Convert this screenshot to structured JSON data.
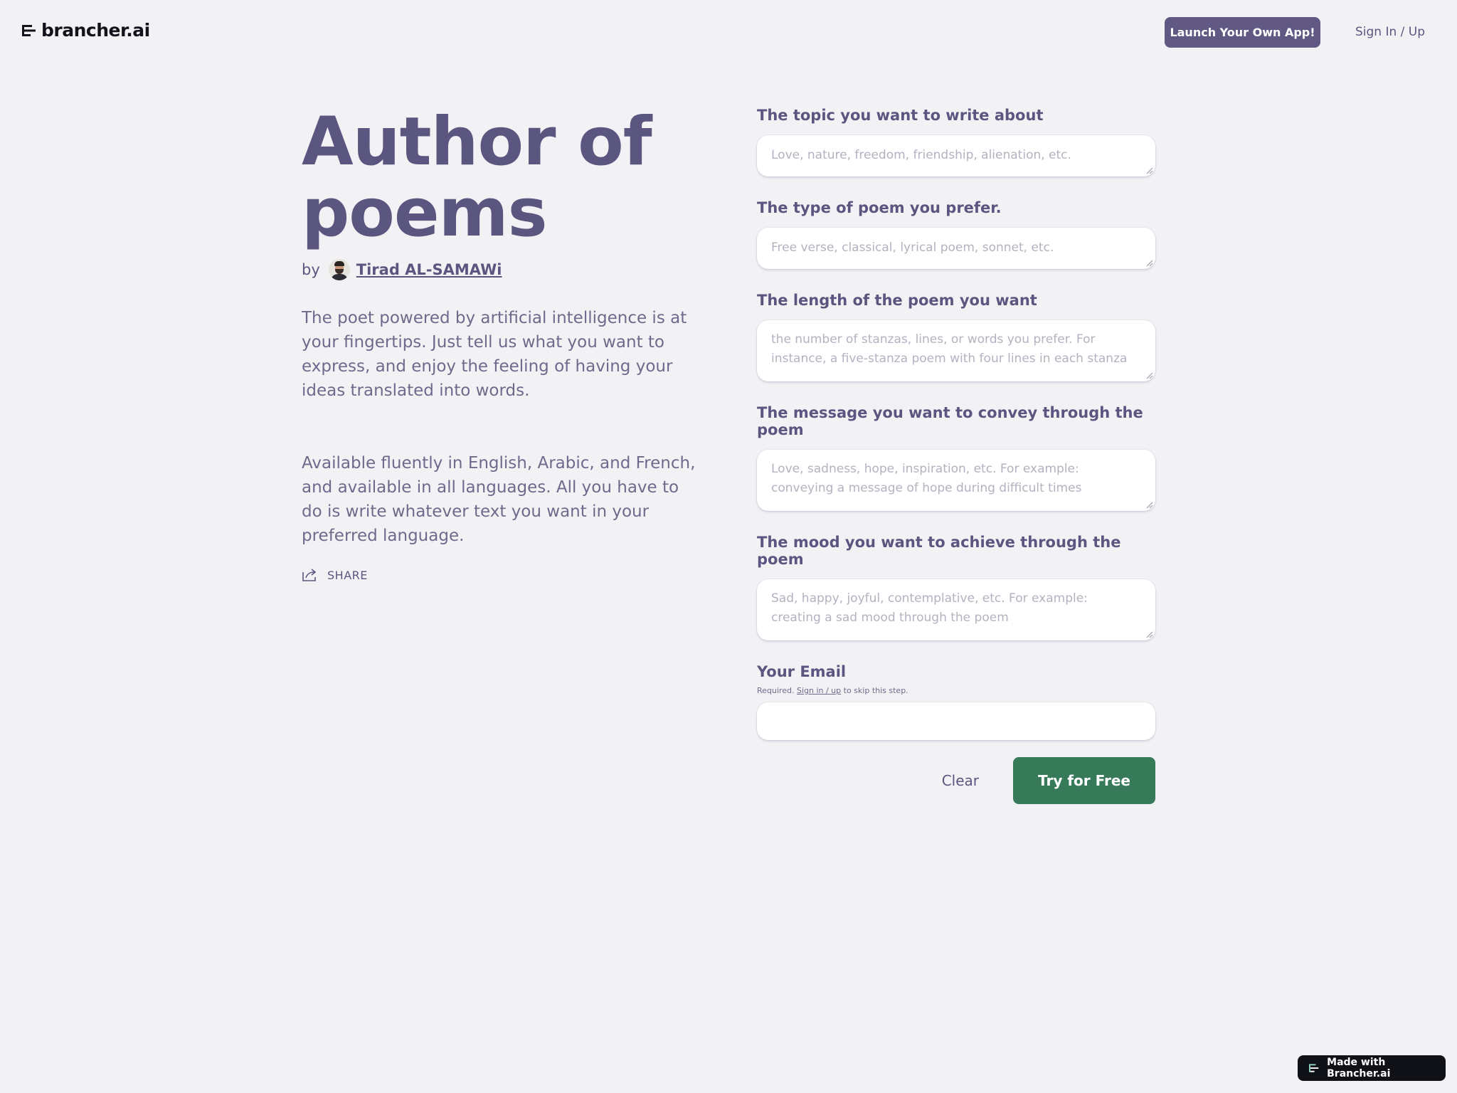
{
  "header": {
    "logo_text": "brancher.ai",
    "launch_label": "Launch Your Own App!",
    "signin_label": "Sign In / Up"
  },
  "intro": {
    "title": "Author of poems",
    "by": "by",
    "author_name": "Tirad AL-SAMAWi",
    "description": "The poet powered by artificial intelligence is at your fingertips. Just tell us what you want to express, and enjoy the feeling of having your ideas translated into words.",
    "description2": "Available fluently in English, Arabic, and French, and available in all languages. All you have to do is write whatever text you want in your preferred language.",
    "share_label": "SHARE"
  },
  "form": {
    "fields": [
      {
        "label": "The topic you want to write about",
        "placeholder": "Love, nature, freedom, friendship, alienation, etc."
      },
      {
        "label": "The type of poem you prefer.",
        "placeholder": "Free verse, classical, lyrical poem, sonnet, etc."
      },
      {
        "label": "The length of the poem you want",
        "placeholder": "the number of stanzas, lines, or words you prefer. For instance, a five-stanza poem with four lines in each stanza"
      },
      {
        "label": "The message you want to convey through the poem",
        "placeholder": "Love, sadness, hope, inspiration, etc. For example: conveying a message of hope during difficult times"
      },
      {
        "label": "The mood you want to achieve through the poem",
        "placeholder": "Sad, happy, joyful, contemplative, etc. For example: creating a sad mood through the poem"
      }
    ],
    "email": {
      "label": "Your Email",
      "note_prefix": "Required.",
      "note_link": "Sign in / up",
      "note_suffix": "to skip this step.",
      "value": ""
    },
    "clear_label": "Clear",
    "submit_label": "Try for Free"
  },
  "footer": {
    "made_with_label": "Made with Brancher.ai"
  },
  "colors": {
    "background": "#f2f2f5",
    "accent_purple": "#615984",
    "text_purple": "#5a5680",
    "button_green": "#377a5a",
    "badge_dark": "#111118"
  }
}
